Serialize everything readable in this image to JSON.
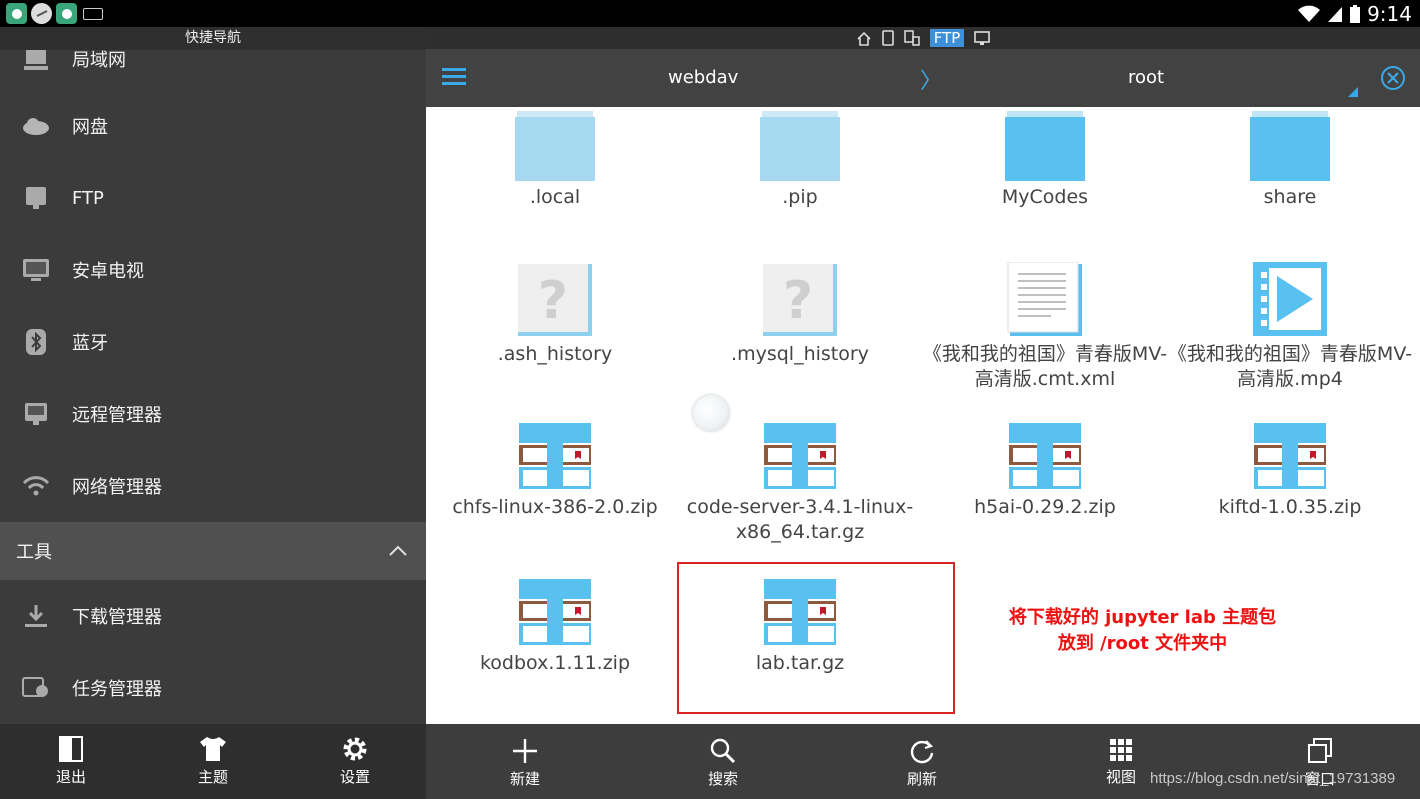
{
  "status_bar": {
    "time": "9:14"
  },
  "drawer": {
    "title": "快捷导航",
    "items": [
      {
        "label": "局域网",
        "icon": "lan-icon"
      },
      {
        "label": "网盘",
        "icon": "cloud-icon"
      },
      {
        "label": "FTP",
        "icon": "ftp-server-icon"
      },
      {
        "label": "安卓电视",
        "icon": "tv-icon"
      },
      {
        "label": "蓝牙",
        "icon": "bluetooth-icon"
      },
      {
        "label": "远程管理器",
        "icon": "remote-ftp-icon"
      },
      {
        "label": "网络管理器",
        "icon": "wifi-icon"
      }
    ],
    "section": {
      "label": "工具"
    },
    "tool_items": [
      {
        "label": "下载管理器",
        "icon": "download-icon"
      },
      {
        "label": "任务管理器",
        "icon": "task-manager-icon"
      }
    ],
    "bottom": {
      "exit": "退出",
      "theme": "主题",
      "settings": "设置"
    }
  },
  "top_icons": {
    "ftp_label": "FTP"
  },
  "path": {
    "segment1": "webdav",
    "separator": "〉",
    "segment2": "root"
  },
  "files": [
    {
      "name": ".local",
      "icon": "folder-light-icon"
    },
    {
      "name": ".pip",
      "icon": "folder-light-icon"
    },
    {
      "name": "MyCodes",
      "icon": "folder-icon"
    },
    {
      "name": "share",
      "icon": "folder-icon"
    },
    {
      "name": ".ash_history",
      "icon": "unknown-file-icon"
    },
    {
      "name": ".mysql_history",
      "icon": "unknown-file-icon"
    },
    {
      "name": "《我和我的祖国》青春版MV-高清版.cmt.xml",
      "icon": "text-file-icon"
    },
    {
      "name": "《我和我的祖国》青春版MV-高清版.mp4",
      "icon": "video-file-icon"
    },
    {
      "name": "chfs-linux-386-2.0.zip",
      "icon": "archive-icon"
    },
    {
      "name": "code-server-3.4.1-linux-x86_64.tar.gz",
      "icon": "archive-icon"
    },
    {
      "name": "h5ai-0.29.2.zip",
      "icon": "archive-icon"
    },
    {
      "name": "kiftd-1.0.35.zip",
      "icon": "archive-icon"
    },
    {
      "name": "kodbox.1.11.zip",
      "icon": "archive-icon"
    },
    {
      "name": "lab.tar.gz",
      "icon": "archive-icon"
    }
  ],
  "annotation": {
    "line1": "将下载好的 jupyter lab 主题包",
    "line2": "放到 /root 文件夹中",
    "color": "#e11111"
  },
  "bottom_bar": {
    "new": "新建",
    "search": "搜索",
    "refresh": "刷新",
    "view": "视图",
    "window": "窗口"
  },
  "watermark": "https://blog.csdn.net/sinat_19731389",
  "colors": {
    "accent": "#3aa9e8",
    "folder": "#59c1ef",
    "drawer_bg": "#3b3b3b"
  }
}
